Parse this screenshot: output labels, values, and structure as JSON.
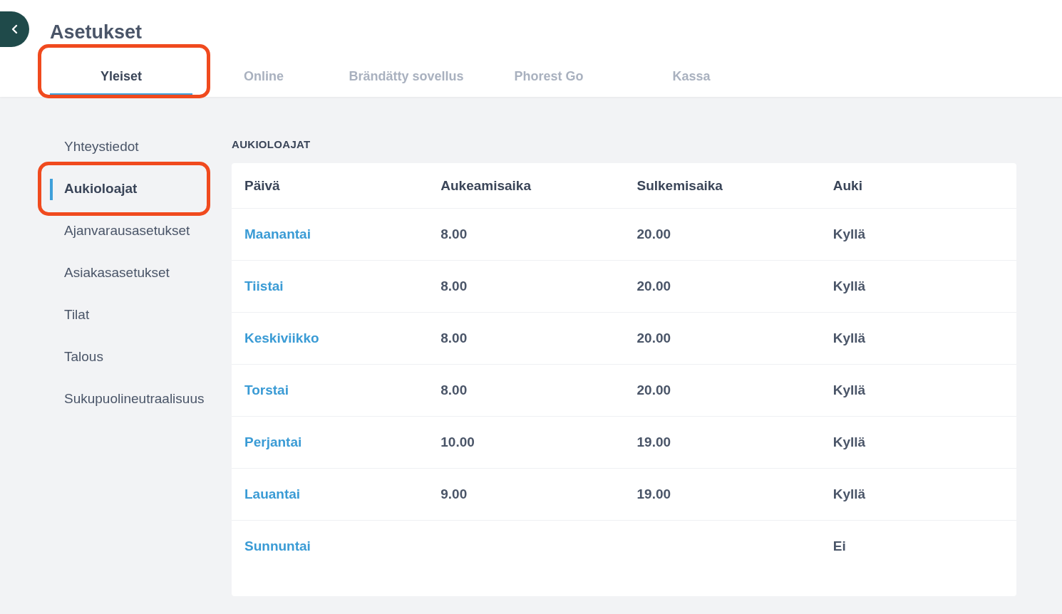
{
  "header": {
    "title": "Asetukset"
  },
  "tabs": [
    {
      "label": "Yleiset",
      "selected": true,
      "highlighted": true
    },
    {
      "label": "Online",
      "selected": false,
      "highlighted": false
    },
    {
      "label": "Brändätty sovellus",
      "selected": false,
      "highlighted": false
    },
    {
      "label": "Phorest Go",
      "selected": false,
      "highlighted": false
    },
    {
      "label": "Kassa",
      "selected": false,
      "highlighted": false
    }
  ],
  "sidebar": {
    "items": [
      {
        "label": "Yhteystiedot",
        "selected": false,
        "highlighted": false
      },
      {
        "label": "Aukioloajat",
        "selected": true,
        "highlighted": true
      },
      {
        "label": "Ajanvarausasetukset",
        "selected": false,
        "highlighted": false
      },
      {
        "label": "Asiakasasetukset",
        "selected": false,
        "highlighted": false
      },
      {
        "label": "Tilat",
        "selected": false,
        "highlighted": false
      },
      {
        "label": "Talous",
        "selected": false,
        "highlighted": false
      },
      {
        "label": "Sukupuolineutraalisuus",
        "selected": false,
        "highlighted": false
      }
    ]
  },
  "section": {
    "title": "AUKIOLOAJAT"
  },
  "table": {
    "columns": [
      "Päivä",
      "Aukeamisaika",
      "Sulkemisaika",
      "Auki"
    ],
    "rows": [
      {
        "day": "Maanantai",
        "opens": "8.00",
        "closes": "20.00",
        "open": "Kyllä"
      },
      {
        "day": "Tiistai",
        "opens": "8.00",
        "closes": "20.00",
        "open": "Kyllä"
      },
      {
        "day": "Keskiviikko",
        "opens": "8.00",
        "closes": "20.00",
        "open": "Kyllä"
      },
      {
        "day": "Torstai",
        "opens": "8.00",
        "closes": "20.00",
        "open": "Kyllä"
      },
      {
        "day": "Perjantai",
        "opens": "10.00",
        "closes": "19.00",
        "open": "Kyllä"
      },
      {
        "day": "Lauantai",
        "opens": "9.00",
        "closes": "19.00",
        "open": "Kyllä"
      },
      {
        "day": "Sunnuntai",
        "open": "Ei"
      }
    ]
  }
}
